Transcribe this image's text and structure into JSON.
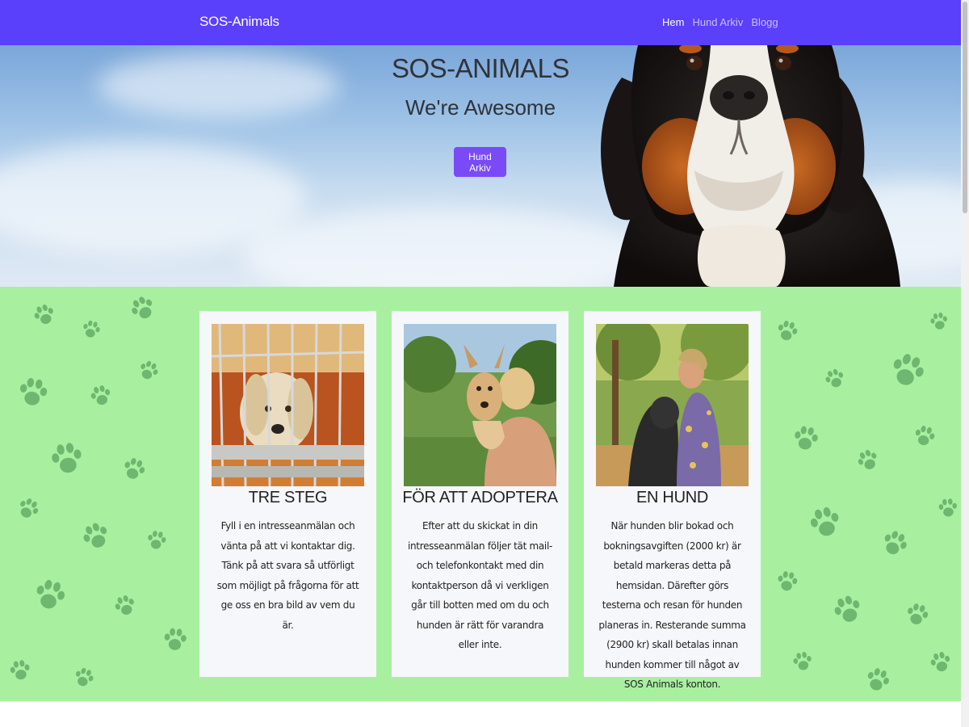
{
  "navbar": {
    "brand": "SOS-Animals",
    "links": [
      {
        "label": "Hem",
        "active": true
      },
      {
        "label": "Hund Arkiv",
        "active": false
      },
      {
        "label": "Blogg",
        "active": false
      }
    ]
  },
  "hero": {
    "title": "SOS-ANIMALS",
    "subtitle": "We're Awesome",
    "button_label": "Hund Arkiv"
  },
  "cards": [
    {
      "title": "TRE STEG",
      "text": "Fyll i en intresseanmälan och vänta på att vi kontaktar dig. Tänk på att svara så utförligt som möjligt på frågorna för att ge oss en bra bild av vem du är."
    },
    {
      "title": "FÖR ATT ADOPTERA",
      "text": "Efter att du skickat in din intresseanmälan följer tät mail- och telefonkontakt med din kontaktperson då vi verkligen går till botten med om du och hunden är rätt för varandra eller inte."
    },
    {
      "title": "EN HUND",
      "text": "När hunden blir bokad och bokningsavgiften (2000 kr) är betald markeras detta på hemsidan. Därefter görs testerna och resan för hunden planeras in. Resterande summa (2900 kr) skall betalas innan hunden kommer till något av SOS Animals konton."
    }
  ],
  "colors": {
    "navbar": "#5a3ffb",
    "button": "#7a4af7",
    "section_bg": "#a8f0a0",
    "paw": "#3f8a4a",
    "card_bg": "#f6f7fa"
  }
}
